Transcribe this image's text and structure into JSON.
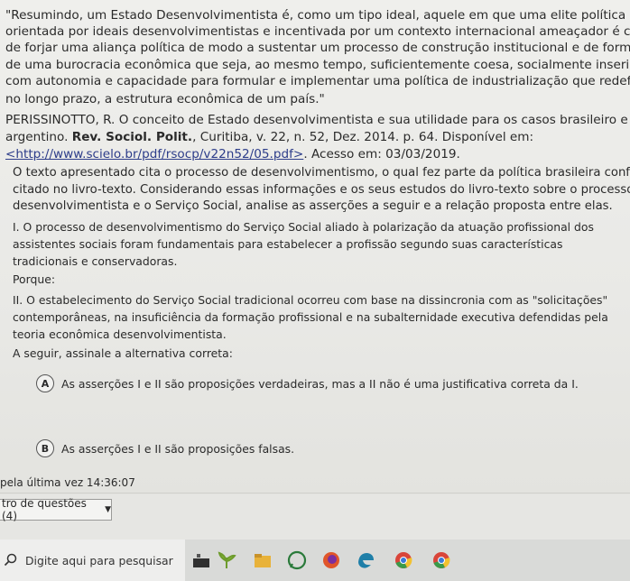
{
  "quote_lines": [
    "\"Resumindo, um Estado Desenvolvimentista é, como um tipo ideal, aquele em que uma elite política",
    "orientada por ideais desenvolvimentistas e incentivada por um contexto internacional ameaçador é capaz",
    "de forjar uma aliança política de modo a sustentar um processo de construção institucional e de formação",
    "de uma burocracia econômica que seja, ao mesmo tempo, suficientemente coesa, socialmente inserida,",
    "com autonomia e capacidade para formular e implementar uma política de industrialização que redefina,",
    "no longo prazo, a estrutura econômica de um país.\""
  ],
  "reference": {
    "line1": "PERISSINOTTO, R. O conceito de Estado desenvolvimentista e sua utilidade para os casos brasileiro e",
    "line2_prefix": "argentino. ",
    "journal": "Rev. Sociol. Polit.",
    "line2_suffix": ", Curitiba, v. 22, n. 52, Dez. 2014. p. 64. Disponível em:",
    "url": "<http://www.scielo.br/pdf/rsocp/v22n52/05.pdf>",
    "access": ". Acesso em: 03/03/2019."
  },
  "context_lines": [
    "O texto apresentado cita o processo de desenvolvimentismo, o qual fez parte da política brasileira conforme",
    "citado no livro-texto. Considerando essas informações e os seus estudos do livro-texto sobre o processo",
    "desenvolvimentista e o Serviço Social, analise as asserções a seguir e a relação proposta entre elas."
  ],
  "assertion1_lines": [
    "I. O processo de desenvolvimentismo do Serviço Social aliado à polarização da atuação profissional dos",
    "assistentes sociais foram fundamentais para estabelecer a profissão segundo suas características",
    "tradicionais e conservadoras."
  ],
  "porque": "Porque:",
  "assertion2_lines": [
    "II. O estabelecimento do Serviço Social tradicional ocorreu com base na dissincronia com as \"solicitações\"",
    "contemporâneas, na insuficiência da formação profissional e na subalternidade executiva defendidas pela",
    "teoria econômica desenvolvimentista."
  ],
  "instruction": "A seguir, assinale a alternativa correta:",
  "options": [
    {
      "letter": "A",
      "text": "As asserções I e II são proposições verdadeiras, mas a II não é uma justificativa correta da I."
    },
    {
      "letter": "B",
      "text": "As asserções I e II são proposições falsas."
    }
  ],
  "status": "pela última vez 14:36:07",
  "question_nav": {
    "label": "tro de questões (4)"
  },
  "taskbar": {
    "search_placeholder": "Digite aqui para pesquisar"
  }
}
